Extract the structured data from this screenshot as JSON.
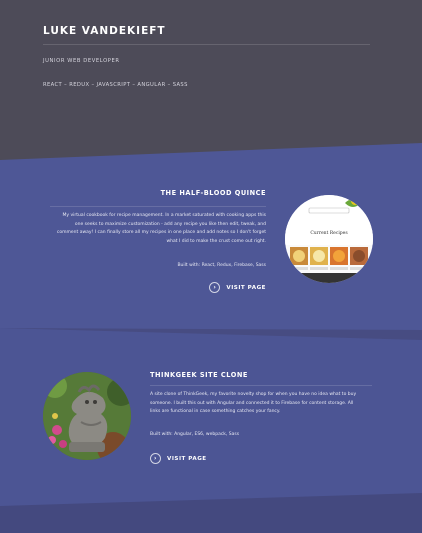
{
  "header": {
    "name": "LUKE VANDEKIEFT",
    "role": "JUNIOR WEB DEVELOPER",
    "skills": "REACT – REDUX – JAVASCRIPT – ANGULAR – SASS"
  },
  "projects": [
    {
      "title": "THE HALF-BLOOD QUINCE",
      "desc_lines": [
        "My virtual cookbook for recipe management. In a market saturated with cooking apps this",
        "one seeks to maximize customization - add any recipe you like then edit, tweak, and",
        "comment away! I can finally store all my recipes in one place and add notes so I don't forget",
        "what I did to make the crust come out right."
      ],
      "built": "Built with: React, Redux, Firebase, Sass",
      "visit_label": "VISIT PAGE",
      "screenshot_heading": "Current Recipes"
    },
    {
      "title": "THINKGEEK SITE CLONE",
      "desc_lines": [
        "A site clone of ThinkGeek, my favorite novelty shop for when you have no idea what to buy",
        "someone. I built this out with Angular and connected it to Firebase for content storage. All",
        "links are functional in case something catches your fancy."
      ],
      "built": "Built with: Angular, ES6, webpack, Sass",
      "visit_label": "VISIT PAGE"
    }
  ],
  "colors": {
    "header_bg": "#4d4b58",
    "section_bg": "#4e5796"
  },
  "icons": {
    "visit": "chevron-right-icon"
  }
}
